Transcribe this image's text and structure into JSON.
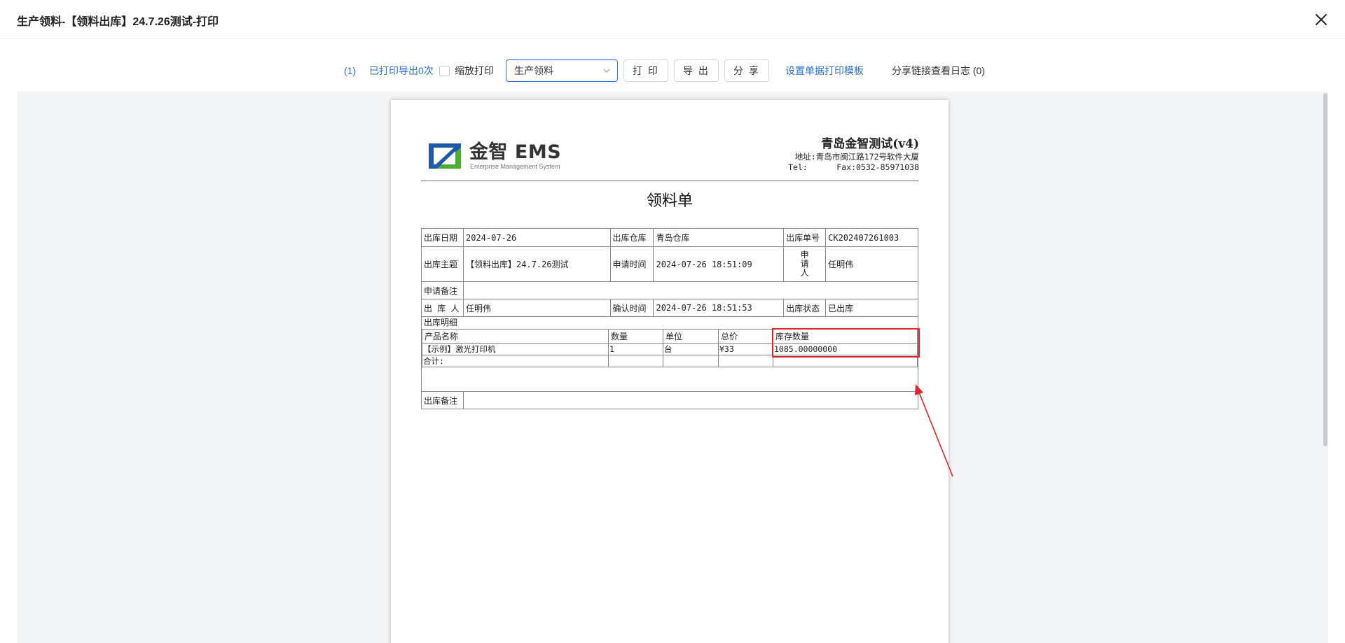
{
  "header": {
    "title": "生产领料-【领料出库】24.7.26测试-打印",
    "close_icon": "close-icon"
  },
  "toolbar": {
    "count_label": "(1)",
    "printed_label": "已打印导出0次",
    "scale_print_label": "缩放打印",
    "scale_print_checked": false,
    "template_select_value": "生产领料",
    "print_button": "打 印",
    "export_button": "导 出",
    "share_button": "分 享",
    "set_template_link": "设置单据打印模板",
    "share_log_label": "分享链接查看日志 (0)"
  },
  "document": {
    "logo_text": "金智 EMS",
    "logo_subtext": "Enterprise Management System",
    "company_name": "青岛金智测试(v4)",
    "address": "地址:青岛市闽江路172号软件大厦",
    "tel": "Tel:      Fax:0532-85971038",
    "title": "领料单",
    "fields": {
      "out_date_label": "出库日期",
      "out_date": "2024-07-26",
      "warehouse_label": "出库仓库",
      "warehouse": "青岛仓库",
      "order_no_label": "出库单号",
      "order_no": "CK202407261003",
      "subject_label": "出库主题",
      "subject": "【领料出库】24.7.26测试",
      "apply_time_label": "申请时间",
      "apply_time": "2024-07-26 18:51:09",
      "applicant_label": "申请人",
      "applicant": "任明伟",
      "apply_note_label": "申请备注",
      "apply_note": "",
      "operator_label": "出 库 人",
      "operator": "任明伟",
      "confirm_time_label": "确认时间",
      "confirm_time": "2024-07-26 18:51:53",
      "status_label": "出库状态",
      "status": "已出库",
      "detail_label": "出库明细",
      "out_note_label": "出库备注",
      "out_note": ""
    },
    "detail_table": {
      "columns": [
        "产品名称",
        "数量",
        "单位",
        "总价",
        "库存数量"
      ],
      "rows": [
        [
          "【示例】激光打印机",
          "1",
          "台",
          "¥33",
          "1085.00000000"
        ]
      ],
      "total_label": "合计:"
    }
  },
  "colors": {
    "accent": "#2a6fd6",
    "annotation": "#e0262a",
    "preview_bg": "#f3f4f6"
  }
}
